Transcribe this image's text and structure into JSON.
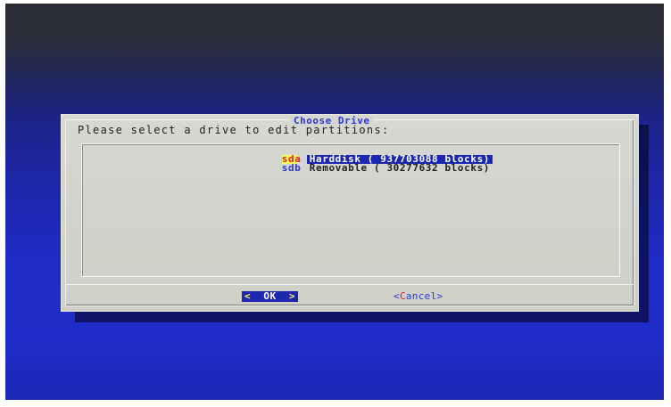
{
  "dialog": {
    "title": "Choose Drive",
    "prompt": "Please select a drive to edit partitions:"
  },
  "drives": [
    {
      "tag": "sda",
      "description": "Harddisk ( 937703088 blocks)",
      "selected": true
    },
    {
      "tag": "sdb",
      "description": "Removable ( 30277632 blocks)",
      "selected": false
    }
  ],
  "buttons": {
    "ok_left": "<",
    "ok_label": "OK",
    "ok_right": ">",
    "cancel_left": "<",
    "cancel_hotkey": "C",
    "cancel_rest": "ancel",
    "cancel_right": ">"
  },
  "colors": {
    "screen_background": "#1f2bc6",
    "dialog_background": "#d6d6d0",
    "title_color": "#2a3bd6",
    "selection_background": "#1c27b0",
    "hotkey_color": "#e02020",
    "tag_highlight": "#fdfd60"
  }
}
